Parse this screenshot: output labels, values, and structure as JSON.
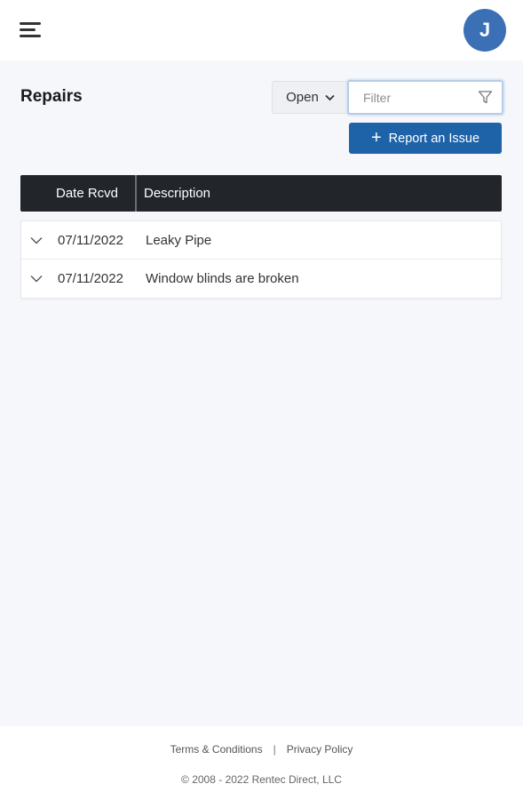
{
  "header": {
    "avatar_initial": "J"
  },
  "page": {
    "title": "Repairs"
  },
  "controls": {
    "status_value": "Open",
    "filter_placeholder": "Filter",
    "report_button_label": "Report an Issue",
    "report_button_icon": "plus-icon"
  },
  "table": {
    "columns": [
      "Date Rcvd",
      "Description"
    ],
    "rows": [
      {
        "date": "07/11/2022",
        "description": "Leaky Pipe"
      },
      {
        "date": "07/11/2022",
        "description": "Window blinds are broken"
      }
    ]
  },
  "footer": {
    "terms_label": "Terms & Conditions",
    "separator": "|",
    "privacy_label": "Privacy Policy",
    "copyright": "© 2008 - 2022 Rentec Direct, LLC"
  },
  "colors": {
    "page_background": "#f5f7fb",
    "primary_button": "#1e63a8",
    "avatar": "#3b6fb6",
    "table_header": "#22252a"
  },
  "icons": {
    "menu": "hamburger-menu-icon",
    "dropdown": "chevron-down-icon",
    "filter": "funnel-filter-icon",
    "row_expand": "chevron-down-icon"
  }
}
